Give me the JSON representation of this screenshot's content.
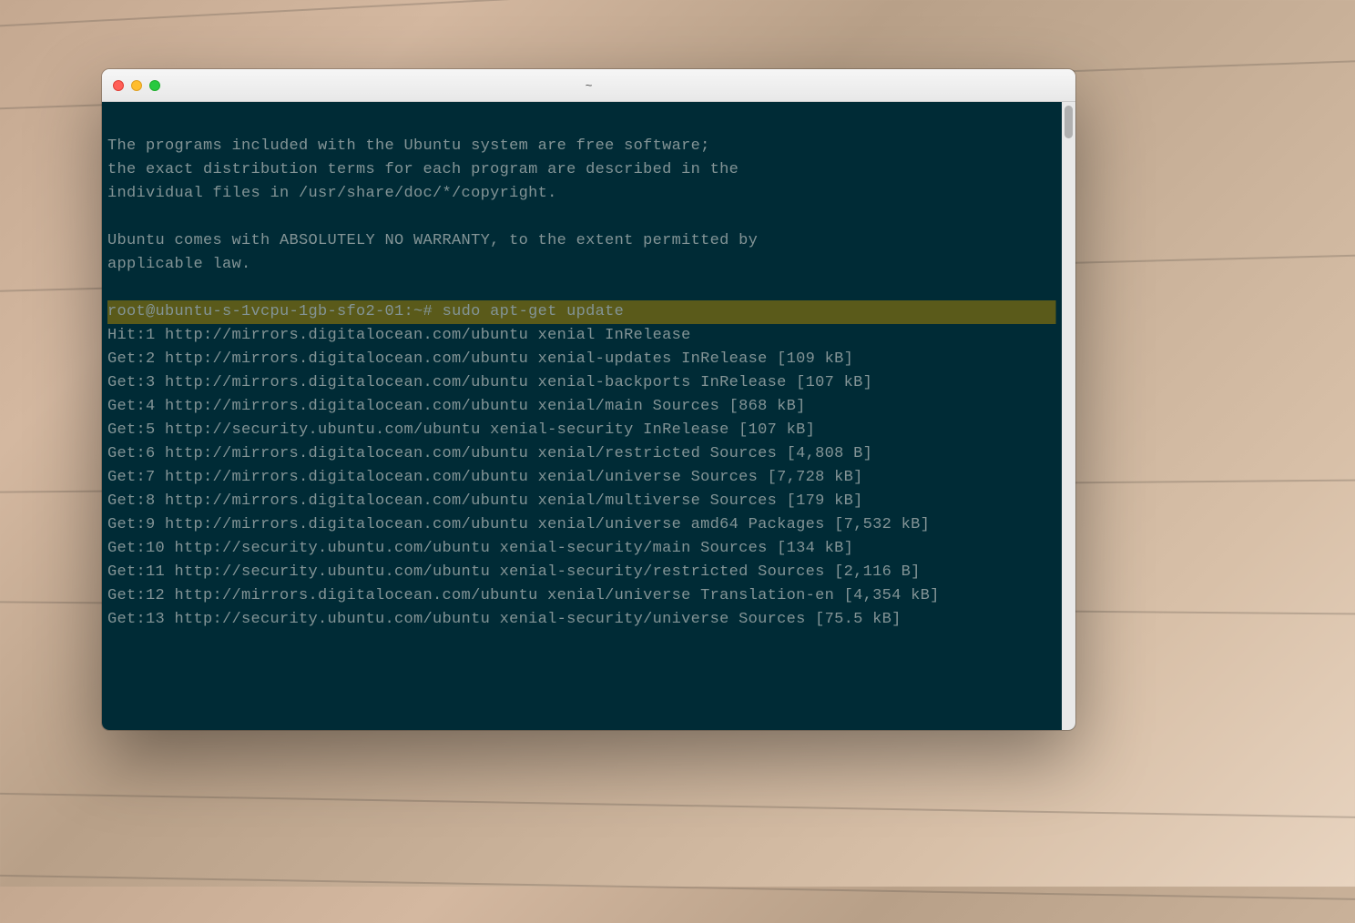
{
  "window": {
    "title": "~"
  },
  "terminal": {
    "intro_lines": [
      "",
      "The programs included with the Ubuntu system are free software;",
      "the exact distribution terms for each program are described in the",
      "individual files in /usr/share/doc/*/copyright.",
      "",
      "Ubuntu comes with ABSOLUTELY NO WARRANTY, to the extent permitted by",
      "applicable law.",
      ""
    ],
    "prompt": "root@ubuntu-s-1vcpu-1gb-sfo2-01:~# ",
    "command": "sudo apt-get update",
    "output_lines": [
      "Hit:1 http://mirrors.digitalocean.com/ubuntu xenial InRelease",
      "Get:2 http://mirrors.digitalocean.com/ubuntu xenial-updates InRelease [109 kB]",
      "Get:3 http://mirrors.digitalocean.com/ubuntu xenial-backports InRelease [107 kB]",
      "Get:4 http://mirrors.digitalocean.com/ubuntu xenial/main Sources [868 kB]",
      "Get:5 http://security.ubuntu.com/ubuntu xenial-security InRelease [107 kB]",
      "Get:6 http://mirrors.digitalocean.com/ubuntu xenial/restricted Sources [4,808 B]",
      "Get:7 http://mirrors.digitalocean.com/ubuntu xenial/universe Sources [7,728 kB]",
      "Get:8 http://mirrors.digitalocean.com/ubuntu xenial/multiverse Sources [179 kB]",
      "Get:9 http://mirrors.digitalocean.com/ubuntu xenial/universe amd64 Packages [7,532 kB]",
      "Get:10 http://security.ubuntu.com/ubuntu xenial-security/main Sources [134 kB]",
      "Get:11 http://security.ubuntu.com/ubuntu xenial-security/restricted Sources [2,116 B]",
      "Get:12 http://mirrors.digitalocean.com/ubuntu xenial/universe Translation-en [4,354 kB]",
      "Get:13 http://security.ubuntu.com/ubuntu xenial-security/universe Sources [75.5 kB]"
    ]
  }
}
